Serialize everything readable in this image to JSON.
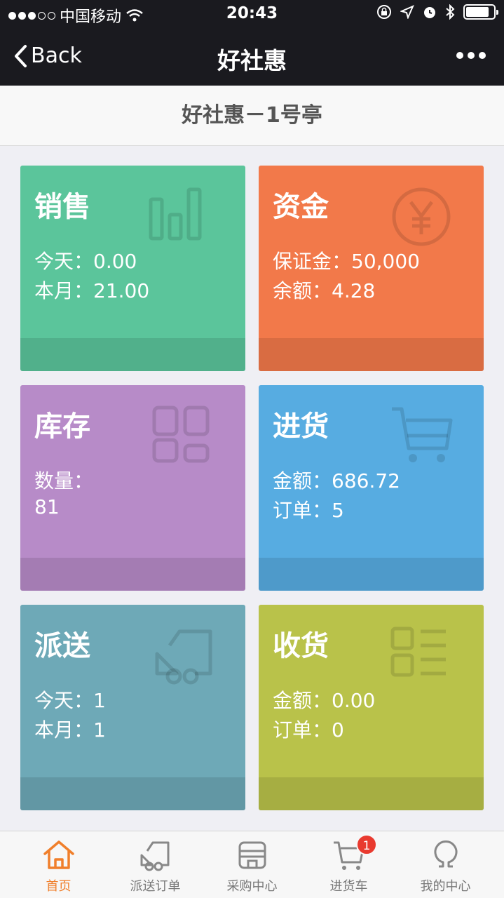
{
  "status_bar": {
    "carrier": "中国移动",
    "time": "20:43"
  },
  "nav": {
    "back_label": "Back",
    "title": "好社惠"
  },
  "store": {
    "name": "好社惠－1号亭"
  },
  "tiles": [
    {
      "key": "sales",
      "title": "销售",
      "line1": "今天：0.00",
      "line2": "本月：21.00",
      "color": "#5bc59b",
      "icon": "bar-chart-icon"
    },
    {
      "key": "funds",
      "title": "资金",
      "line1": "保证金：50,000",
      "line2": "余额：4.28",
      "color": "#f2794a",
      "icon": "yen-icon"
    },
    {
      "key": "inventory",
      "title": "库存",
      "line1": "数量：",
      "line2": "81",
      "color": "#b78bc8",
      "icon": "grid-icon"
    },
    {
      "key": "purchase",
      "title": "进货",
      "line1": "金额：686.72",
      "line2": "订单：5",
      "color": "#57ace1",
      "icon": "cart-icon"
    },
    {
      "key": "delivery",
      "title": "派送",
      "line1": "今天：1",
      "line2": "本月：1",
      "color": "#6ea9b7",
      "icon": "truck-icon"
    },
    {
      "key": "receiving",
      "title": "收货",
      "line1": "金额：0.00",
      "line2": "订单：0",
      "color": "#b9c24a",
      "icon": "list-icon"
    }
  ],
  "tabbar": {
    "items": [
      {
        "label": "首页",
        "icon": "home-icon",
        "active": true
      },
      {
        "label": "派送订单",
        "icon": "truck-icon",
        "active": false
      },
      {
        "label": "采购中心",
        "icon": "store-icon",
        "active": false
      },
      {
        "label": "进货车",
        "icon": "cart-icon",
        "active": false,
        "badge": "1"
      },
      {
        "label": "我的中心",
        "icon": "user-icon",
        "active": false
      }
    ]
  },
  "colors": {
    "accent": "#f07f2b",
    "badge": "#e93a2f",
    "navbar": "#1a1a1f"
  }
}
